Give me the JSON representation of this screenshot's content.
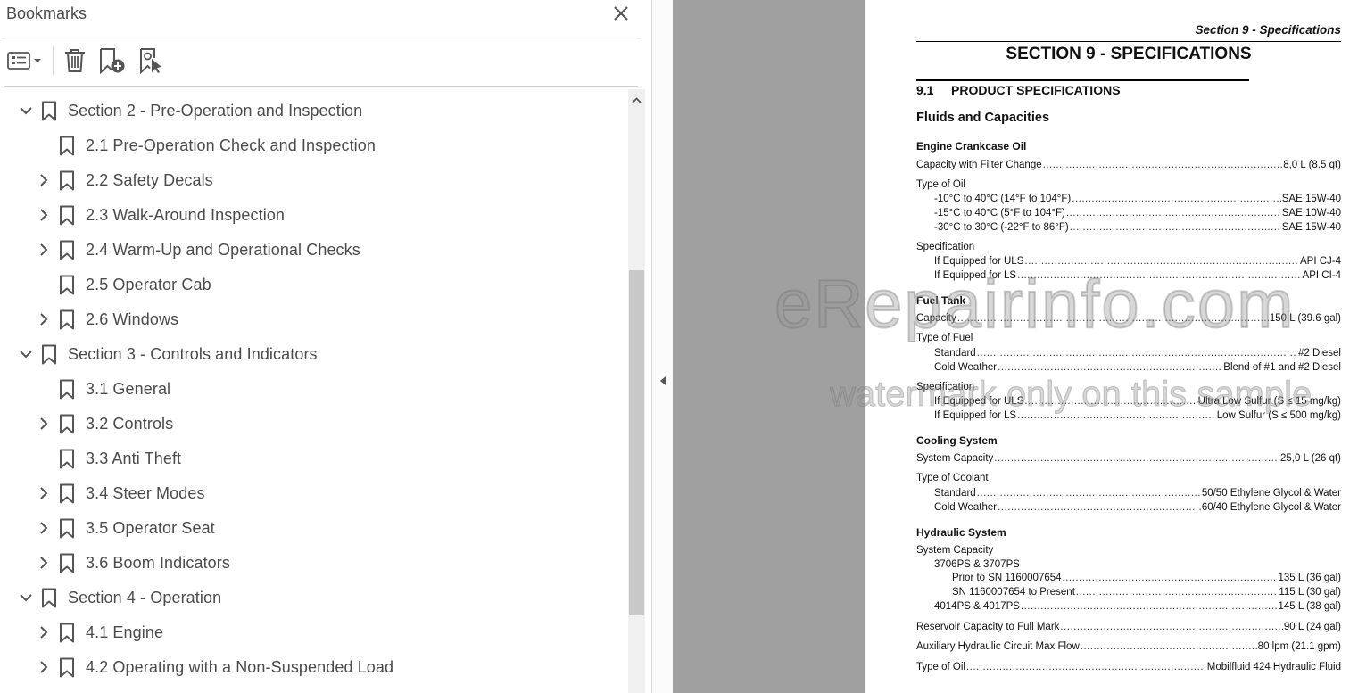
{
  "panel": {
    "title": "Bookmarks",
    "toolbar": {
      "options_icon": "bookmark-options-icon",
      "delete_icon": "delete-bookmark-icon",
      "new_icon": "new-bookmark-icon",
      "find_icon": "find-current-bookmark-icon"
    },
    "tree": [
      {
        "label": "Section 2 - Pre-Operation and Inspection",
        "level": 0,
        "toggle": "expanded"
      },
      {
        "label": "2.1 Pre-Operation Check and Inspection",
        "level": 1,
        "toggle": "none"
      },
      {
        "label": "2.2 Safety Decals",
        "level": 1,
        "toggle": "collapsed"
      },
      {
        "label": "2.3 Walk-Around Inspection",
        "level": 1,
        "toggle": "collapsed"
      },
      {
        "label": "2.4 Warm-Up and Operational Checks",
        "level": 1,
        "toggle": "collapsed"
      },
      {
        "label": "2.5 Operator Cab",
        "level": 1,
        "toggle": "none"
      },
      {
        "label": "2.6 Windows",
        "level": 1,
        "toggle": "collapsed"
      },
      {
        "label": "Section 3 - Controls and Indicators",
        "level": 0,
        "toggle": "expanded"
      },
      {
        "label": "3.1 General",
        "level": 1,
        "toggle": "none"
      },
      {
        "label": "3.2 Controls",
        "level": 1,
        "toggle": "collapsed"
      },
      {
        "label": "3.3 Anti Theft",
        "level": 1,
        "toggle": "none"
      },
      {
        "label": "3.4 Steer Modes",
        "level": 1,
        "toggle": "collapsed"
      },
      {
        "label": "3.5 Operator Seat",
        "level": 1,
        "toggle": "collapsed"
      },
      {
        "label": "3.6 Boom Indicators",
        "level": 1,
        "toggle": "collapsed"
      },
      {
        "label": "Section 4 - Operation",
        "level": 0,
        "toggle": "expanded"
      },
      {
        "label": "4.1 Engine",
        "level": 1,
        "toggle": "collapsed"
      },
      {
        "label": "4.2 Operating with a Non-Suspended Load",
        "level": 1,
        "toggle": "collapsed"
      }
    ]
  },
  "page": {
    "header": "Section 9 - Specifications",
    "title": "SECTION 9 - SPECIFICATIONS",
    "section_num": "9.1",
    "section_title": "PRODUCT SPECIFICATIONS",
    "subtitle": "Fluids and Capacities",
    "headings": {
      "crankcase": "Engine Crankcase Oil",
      "fuel": "Fuel Tank",
      "cooling": "Cooling System",
      "hydraulic": "Hydraulic System"
    },
    "lines": [
      {
        "label": "Capacity with Filter Change",
        "value": "8,0 L (8.5 qt)"
      },
      {
        "label": "Type of Oil"
      },
      {
        "label": "-10°C to 40°C (14°F to 104°F)",
        "value": "SAE 15W-40"
      },
      {
        "label": "-15°C to 40°C (5°F to 104°F)",
        "value": "SAE 10W-40"
      },
      {
        "label": "-30°C to 30°C (-22°F to 86°F)",
        "value": "SAE 15W-40"
      },
      {
        "label": "Specification"
      },
      {
        "label": "If Equipped for ULS",
        "value": "API CJ-4"
      },
      {
        "label": "If Equipped for LS",
        "value": "API CI-4"
      },
      {
        "label": "Capacity",
        "value": "150 L (39.6 gal)"
      },
      {
        "label": "Type of Fuel"
      },
      {
        "label": "Standard",
        "value": "#2 Diesel"
      },
      {
        "label": "Cold Weather",
        "value": "Blend of #1 and #2 Diesel"
      },
      {
        "label": "Specification"
      },
      {
        "label": "If Equipped for ULS",
        "value": "Ultra Low Sulfur (S ≤ 15 mg/kg)"
      },
      {
        "label": "If Equipped for LS",
        "value": "Low Sulfur (S ≤ 500 mg/kg)"
      },
      {
        "label": "System Capacity",
        "value": "25,0 L (26 qt)"
      },
      {
        "label": "Type of Coolant"
      },
      {
        "label": "Standard",
        "value": "50/50 Ethylene Glycol & Water"
      },
      {
        "label": "Cold Weather",
        "value": "60/40 Ethylene Glycol & Water"
      },
      {
        "label": "System Capacity"
      },
      {
        "label": "3706PS & 3707PS"
      },
      {
        "label": "Prior to SN 1160007654",
        "value": "135 L (36 gal)"
      },
      {
        "label": "SN 1160007654 to Present",
        "value": "115 L (30 gal)"
      },
      {
        "label": "4014PS & 4017PS",
        "value": "145 L (38 gal)"
      },
      {
        "label": "Reservoir Capacity to Full Mark",
        "value": "90 L (24 gal)"
      },
      {
        "label": "Auxiliary Hydraulic Circuit Max Flow",
        "value": "80 lpm (21.1 gpm)"
      },
      {
        "label": "Type of Oil",
        "value": "Mobilfluid 424 Hydraulic Fluid"
      }
    ],
    "watermark_main": "eRepairinfo.com",
    "watermark_sub": "watermark only on this sample"
  }
}
